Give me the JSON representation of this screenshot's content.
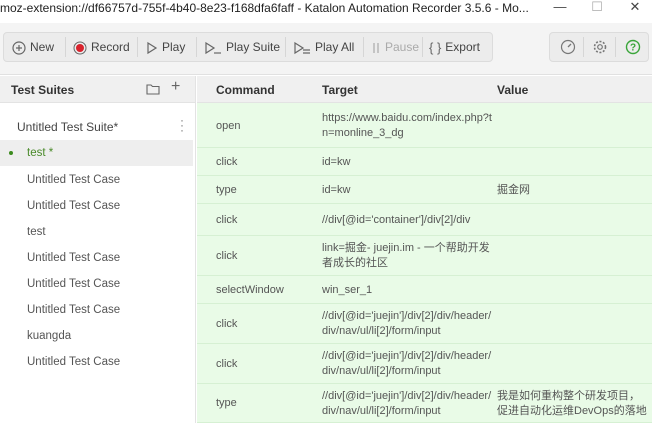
{
  "window": {
    "title": "moz-extension://df66757d-755f-4b40-8e23-f168dfa6faff - Katalon Automation Recorder 3.5.6 - Mo...",
    "min_glyph": "—",
    "max_glyph": "☐",
    "close_glyph": "✕"
  },
  "toolbar": {
    "new_label": "New",
    "record_label": "Record",
    "play_label": "Play",
    "play_suite_label": "Play Suite",
    "play_all_label": "Play All",
    "pause_label": "Pause",
    "export_label": "Export",
    "record_color": "#d9232d",
    "help_color": "#3aa53a"
  },
  "suites": {
    "header": "Test Suites",
    "suite_name": "Untitled Test Suite*",
    "cases": [
      {
        "label": "test *",
        "selected": true
      },
      {
        "label": "Untitled Test Case"
      },
      {
        "label": "Untitled Test Case"
      },
      {
        "label": "test"
      },
      {
        "label": "Untitled Test Case"
      },
      {
        "label": "Untitled Test Case"
      },
      {
        "label": "Untitled Test Case"
      },
      {
        "label": "kuangda"
      },
      {
        "label": "Untitled Test Case"
      }
    ]
  },
  "table": {
    "headers": {
      "command": "Command",
      "target": "Target",
      "value": "Value"
    },
    "rows": [
      {
        "command": "open",
        "target": "https://www.baidu.com/index.php?tn=monline_3_dg",
        "value": ""
      },
      {
        "command": "click",
        "target": "id=kw",
        "value": ""
      },
      {
        "command": "type",
        "target": "id=kw",
        "value": "掘金网"
      },
      {
        "command": "click",
        "target": "//div[@id='container']/div[2]/div",
        "value": ""
      },
      {
        "command": "click",
        "target": "link=掘金- juejin.im - 一个帮助开发者成长的社区",
        "value": ""
      },
      {
        "command": "selectWindow",
        "target": "win_ser_1",
        "value": ""
      },
      {
        "command": "click",
        "target": "//div[@id='juejin']/div[2]/div/header/div/nav/ul/li[2]/form/input",
        "value": ""
      },
      {
        "command": "click",
        "target": "//div[@id='juejin']/div[2]/div/header/div/nav/ul/li[2]/form/input",
        "value": ""
      },
      {
        "command": "type",
        "target": "//div[@id='juejin']/div[2]/div/header/div/nav/ul/li[2]/form/input",
        "value": "我是如何重构整个研发项目，促进自动化运维DevOps的落地"
      }
    ]
  }
}
